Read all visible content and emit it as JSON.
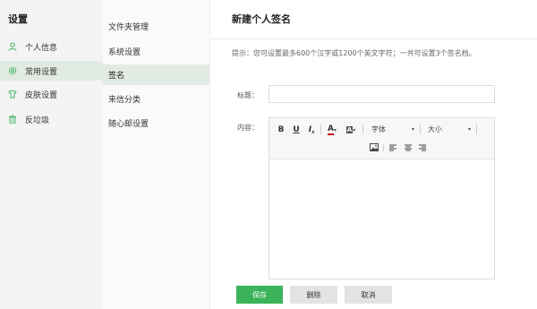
{
  "settings": {
    "title": "设置",
    "items": [
      {
        "label": "个人信息",
        "icon": "user-icon",
        "active": false
      },
      {
        "label": "常用设置",
        "icon": "gear-icon",
        "active": true
      },
      {
        "label": "皮肤设置",
        "icon": "shirt-icon",
        "active": false
      },
      {
        "label": "反垃圾",
        "icon": "trash-icon",
        "active": false
      }
    ]
  },
  "menu": {
    "items": [
      {
        "label": "文件夹管理",
        "active": false
      },
      {
        "label": "系统设置",
        "active": false
      },
      {
        "label": "签名",
        "active": true
      },
      {
        "label": "来信分类",
        "active": false
      },
      {
        "label": "随心邮设置",
        "active": false
      }
    ]
  },
  "main": {
    "title": "新建个人签名",
    "hint": "提示：您可设置最多600个汉字或1200个英文字符；一共可设置3个签名档。",
    "title_label": "标题：",
    "title_value": "",
    "content_label": "内容：",
    "toolbar": {
      "bold": "B",
      "underline": "U",
      "italic": "I",
      "font_color": "A",
      "bg_color": "A",
      "font_family": "字体",
      "font_size": "大小"
    },
    "buttons": {
      "save": "保存",
      "delete": "删除",
      "cancel": "取消"
    }
  },
  "colors": {
    "accent": "#3ab35a",
    "active_bg": "#e2ebe3"
  }
}
